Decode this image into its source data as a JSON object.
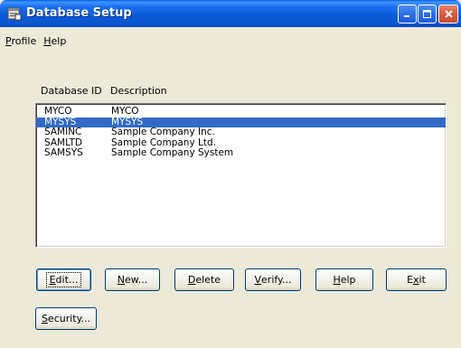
{
  "window": {
    "title": "Database Setup"
  },
  "menu": {
    "profile_prefix": "",
    "profile_hotkey": "P",
    "profile_rest": "rofile",
    "help_hotkey": "H",
    "help_rest": "elp"
  },
  "list": {
    "header_id": "Database ID",
    "header_description": "Description",
    "selected_index": 1,
    "rows": [
      {
        "id": "MYCO",
        "description": "MYCO"
      },
      {
        "id": "MYSYS",
        "description": "MYSYS"
      },
      {
        "id": "SAMINC",
        "description": "Sample Company Inc."
      },
      {
        "id": "SAMLTD",
        "description": "Sample Company Ltd."
      },
      {
        "id": "SAMSYS",
        "description": "Sample Company System"
      }
    ]
  },
  "buttons": {
    "edit": {
      "pre": "",
      "hot": "E",
      "post": "dit..."
    },
    "new": {
      "pre": "",
      "hot": "N",
      "post": "ew..."
    },
    "delete": {
      "pre": "",
      "hot": "D",
      "post": "elete"
    },
    "verify": {
      "pre": "",
      "hot": "V",
      "post": "erify..."
    },
    "help": {
      "pre": "",
      "hot": "H",
      "post": "elp"
    },
    "exit": {
      "pre": "E",
      "hot": "x",
      "post": "it"
    },
    "security": {
      "pre": "",
      "hot": "S",
      "post": "ecurity..."
    }
  },
  "icons": {
    "app": "database-icon",
    "minimize": "minimize-icon",
    "maximize": "maximize-icon",
    "close": "close-icon"
  },
  "colors": {
    "selection": "#316ac5",
    "titlebar": "#0a5ad6",
    "close_button": "#d85a3c"
  }
}
